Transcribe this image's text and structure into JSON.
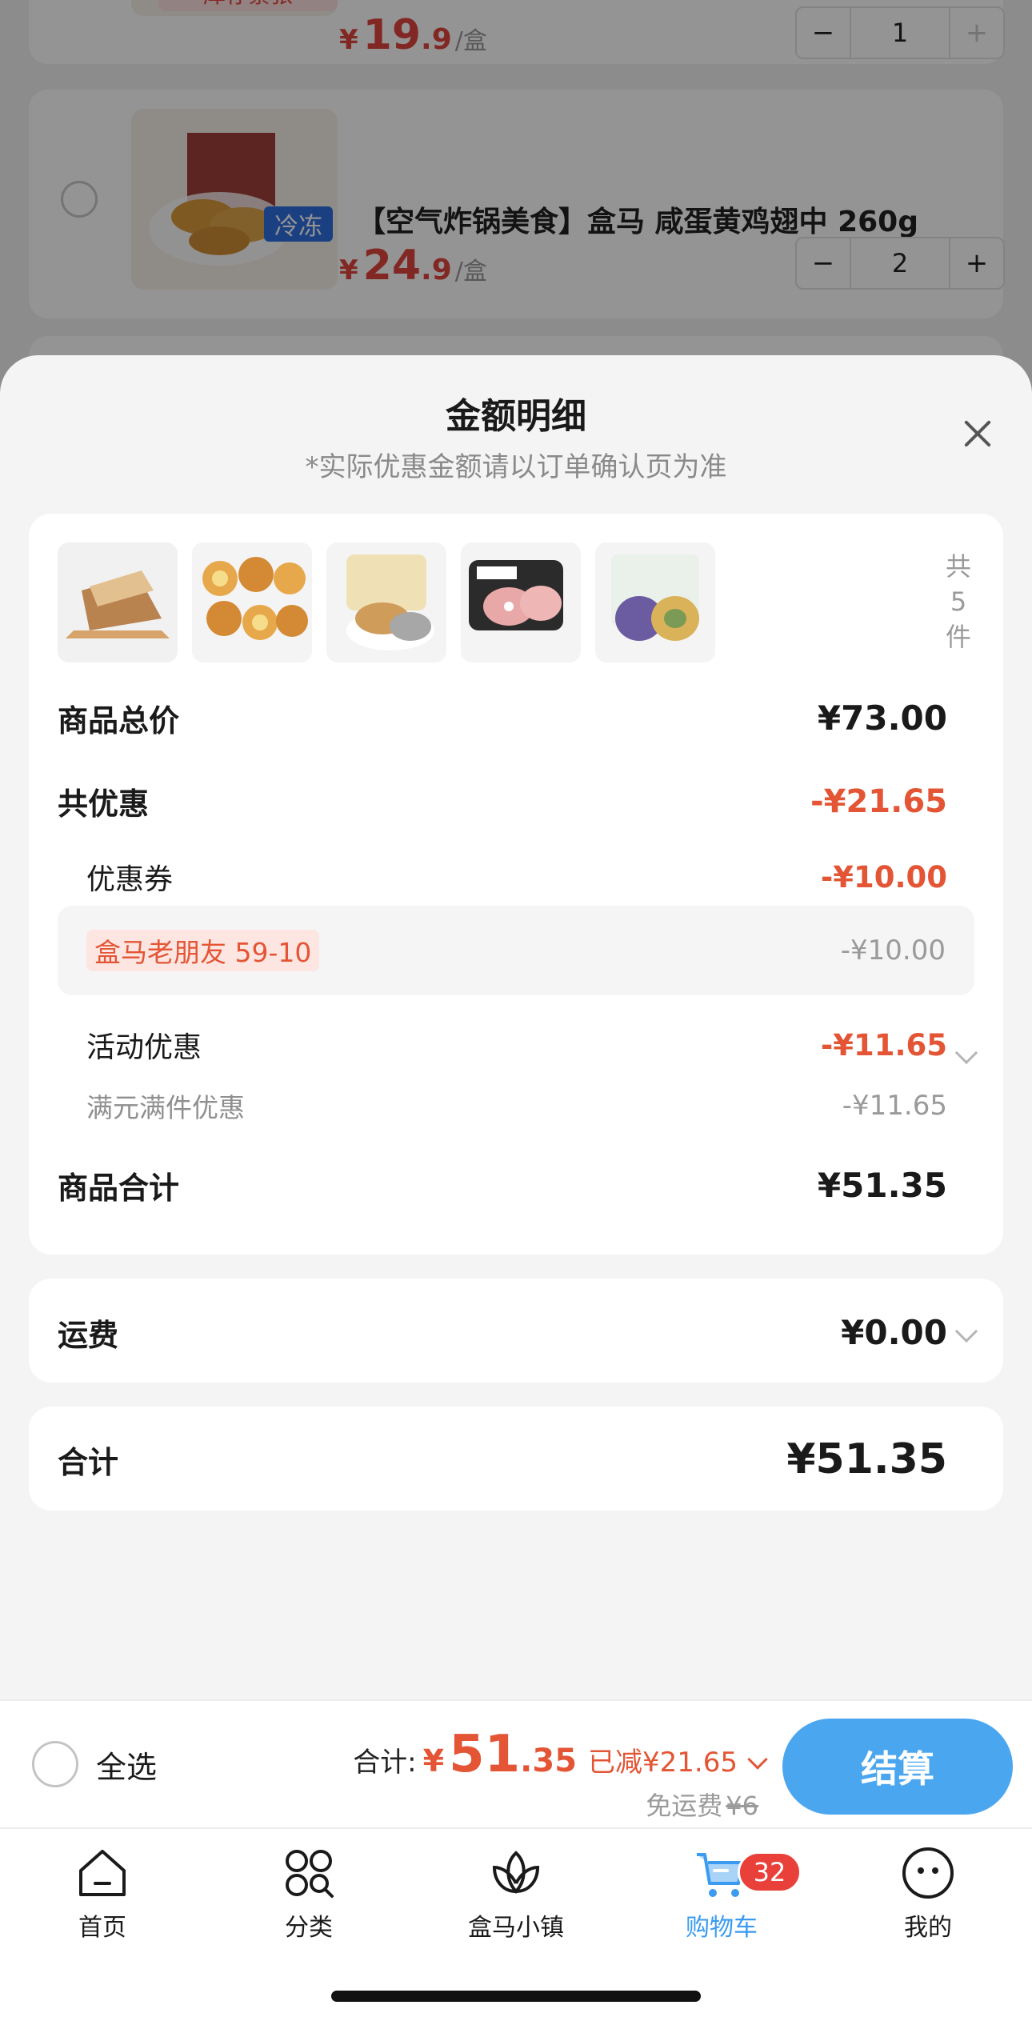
{
  "background": {
    "item1": {
      "stock_tag": "库存紧张",
      "price_cur": "¥",
      "price_int": "19",
      "price_dec": ".9",
      "unit": "/盒",
      "qty": "1"
    },
    "item2": {
      "frozen_tag": "冷冻",
      "title": "【空气炸锅美食】盒马 咸蛋黄鸡翅中 260g",
      "price_cur": "¥",
      "price_int": "24",
      "price_dec": ".9",
      "unit": "/盒",
      "qty": "2"
    },
    "stepper": {
      "minus": "−",
      "plus": "+"
    }
  },
  "sheet": {
    "title": "金额明细",
    "subtitle": "*实际优惠金额请以订单确认页为准",
    "count_label": [
      "共",
      "5",
      "件"
    ],
    "thumbs": [
      "toast-bread",
      "egg-tarts",
      "filled-buns",
      "pork-meat",
      "purple-mooncake"
    ],
    "goods_total_label": "商品总价",
    "goods_total_value": "¥73.00",
    "discount_label": "共优惠",
    "discount_value": "-¥21.65",
    "coupon_label": "优惠券",
    "coupon_value": "-¥10.00",
    "coupon_tag": "盒马老朋友 59-10",
    "coupon_tag_value": "-¥10.00",
    "activity_label": "活动优惠",
    "activity_value": "-¥11.65",
    "activity_sub_label": "满元满件优惠",
    "activity_sub_value": "-¥11.65",
    "subtotal_label": "商品合计",
    "subtotal_value": "¥51.35",
    "shipping_label": "运费",
    "shipping_value": "¥0.00",
    "total_label": "合计",
    "total_value": "¥51.35"
  },
  "checkout": {
    "select_all": "全选",
    "total_label": "合计:",
    "total_cur": "¥",
    "total_int": "51",
    "total_dec": ".35",
    "reduced": "已减¥21.65",
    "free_ship": "免运费",
    "orig_ship": "¥6",
    "pay_button": "结算"
  },
  "tabbar": {
    "tabs": [
      "首页",
      "分类",
      "盒马小镇",
      "购物车",
      "我的"
    ],
    "cart_badge": "32",
    "active": "购物车",
    "active_color": "#3a9bf0"
  },
  "colors": {
    "accent_red": "#e35535",
    "pay_blue": "#4ba6f0"
  }
}
